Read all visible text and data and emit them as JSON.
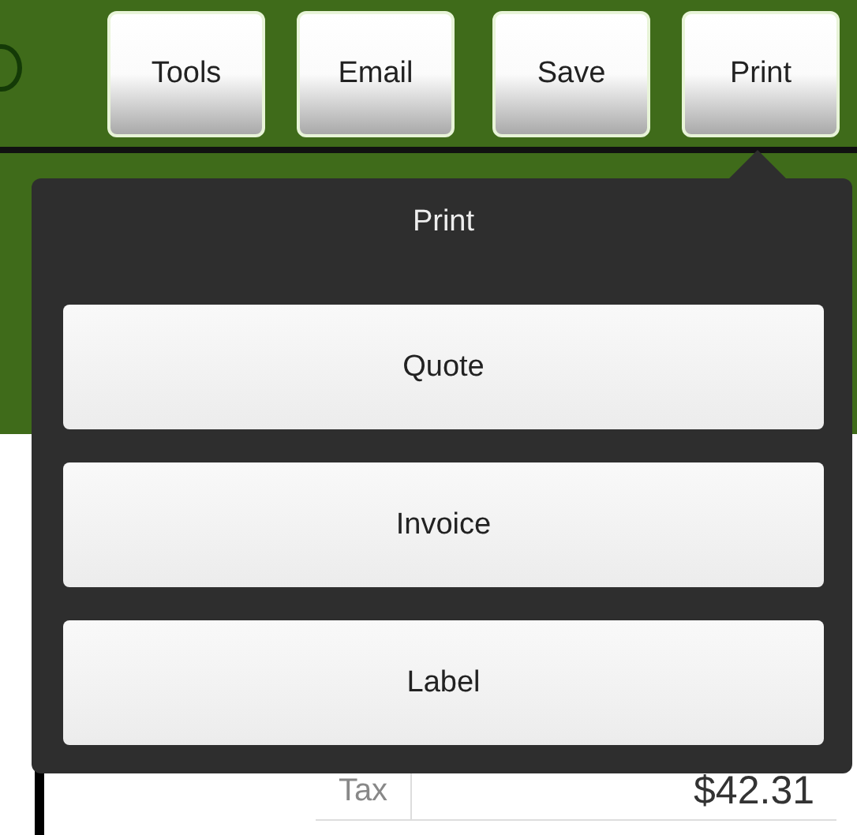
{
  "toolbar": {
    "buttons": [
      "Tools",
      "Email",
      "Save",
      "Print"
    ]
  },
  "popover": {
    "title": "Print",
    "options": [
      "Quote",
      "Invoice",
      "Label"
    ]
  },
  "totals": [
    {
      "label": "Tax",
      "value": "$42.31"
    }
  ]
}
